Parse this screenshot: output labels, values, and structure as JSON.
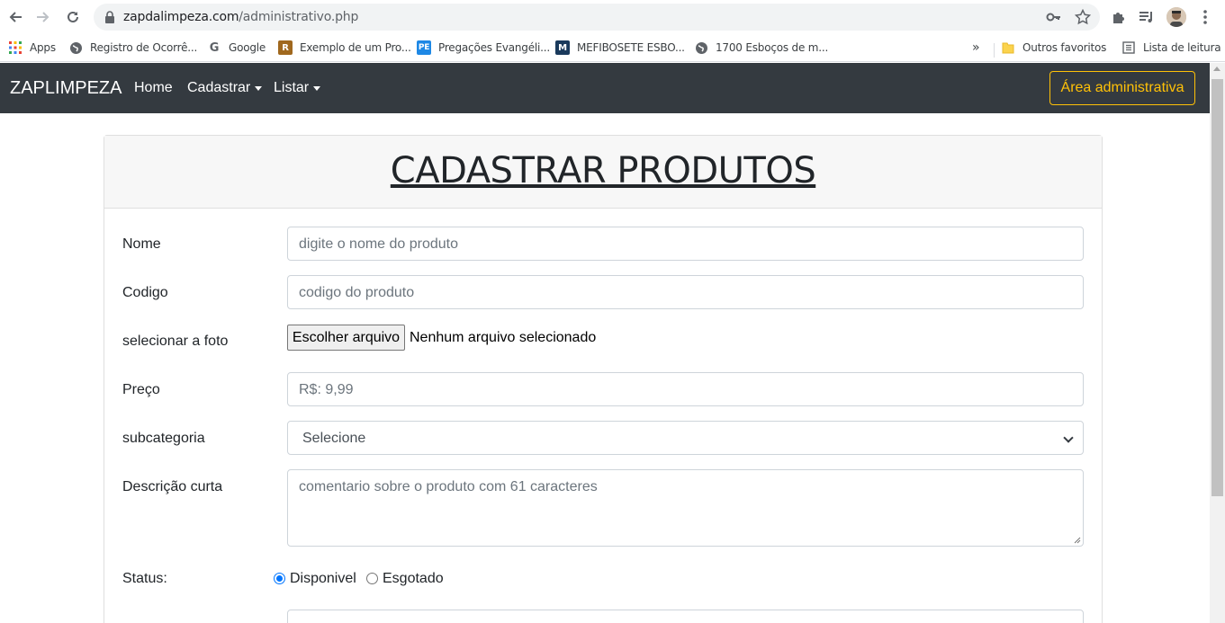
{
  "browser": {
    "url_host": "zapdalimpeza.com",
    "url_path": "/administrativo.php",
    "bookmarks": [
      {
        "label": "Apps",
        "icon": "apps-grid-icon"
      },
      {
        "label": "Registro de Ocorrê...",
        "icon": "globe-icon"
      },
      {
        "label": "Google",
        "icon": "google-icon"
      },
      {
        "label": "Exemplo de um Pro...",
        "icon": "r-logo-icon"
      },
      {
        "label": "Pregações Evangéli...",
        "icon": "pe-logo-icon"
      },
      {
        "label": "MEFIBOSETE ESBO...",
        "icon": "m-logo-icon"
      },
      {
        "label": "1700 Esboços de m...",
        "icon": "globe-icon"
      }
    ],
    "more_bookmarks": "»",
    "other_favorites": "Outros favoritos",
    "reading_list": "Lista de leitura"
  },
  "navbar": {
    "brand": "ZAPLIMPEZA",
    "links": [
      {
        "label": "Home"
      },
      {
        "label": "Cadastrar"
      },
      {
        "label": "Listar"
      }
    ],
    "admin_button": "Área administrativa"
  },
  "form": {
    "title": "CADASTRAR PRODUTOS",
    "nome": {
      "label": "Nome",
      "placeholder": "digite o nome do produto"
    },
    "codigo": {
      "label": "Codigo",
      "placeholder": "codigo do produto"
    },
    "foto": {
      "label": "selecionar a foto",
      "button": "Escolher arquivo",
      "status": "Nenhum arquivo selecionado"
    },
    "preco": {
      "label": "Preço",
      "placeholder": "R$: 9,99"
    },
    "subcategoria": {
      "label": "subcategoria",
      "selected": "Selecione"
    },
    "descricao": {
      "label": "Descrição curta",
      "placeholder": "comentario sobre o produto com 61 caracteres"
    },
    "status": {
      "label": "Status:",
      "options": [
        {
          "label": "Disponivel",
          "checked": true
        },
        {
          "label": "Esgotado",
          "checked": false
        }
      ]
    }
  },
  "colors": {
    "navbar_bg": "#343a40",
    "admin_accent": "#ffc107",
    "radio_accent": "#0075ff"
  }
}
